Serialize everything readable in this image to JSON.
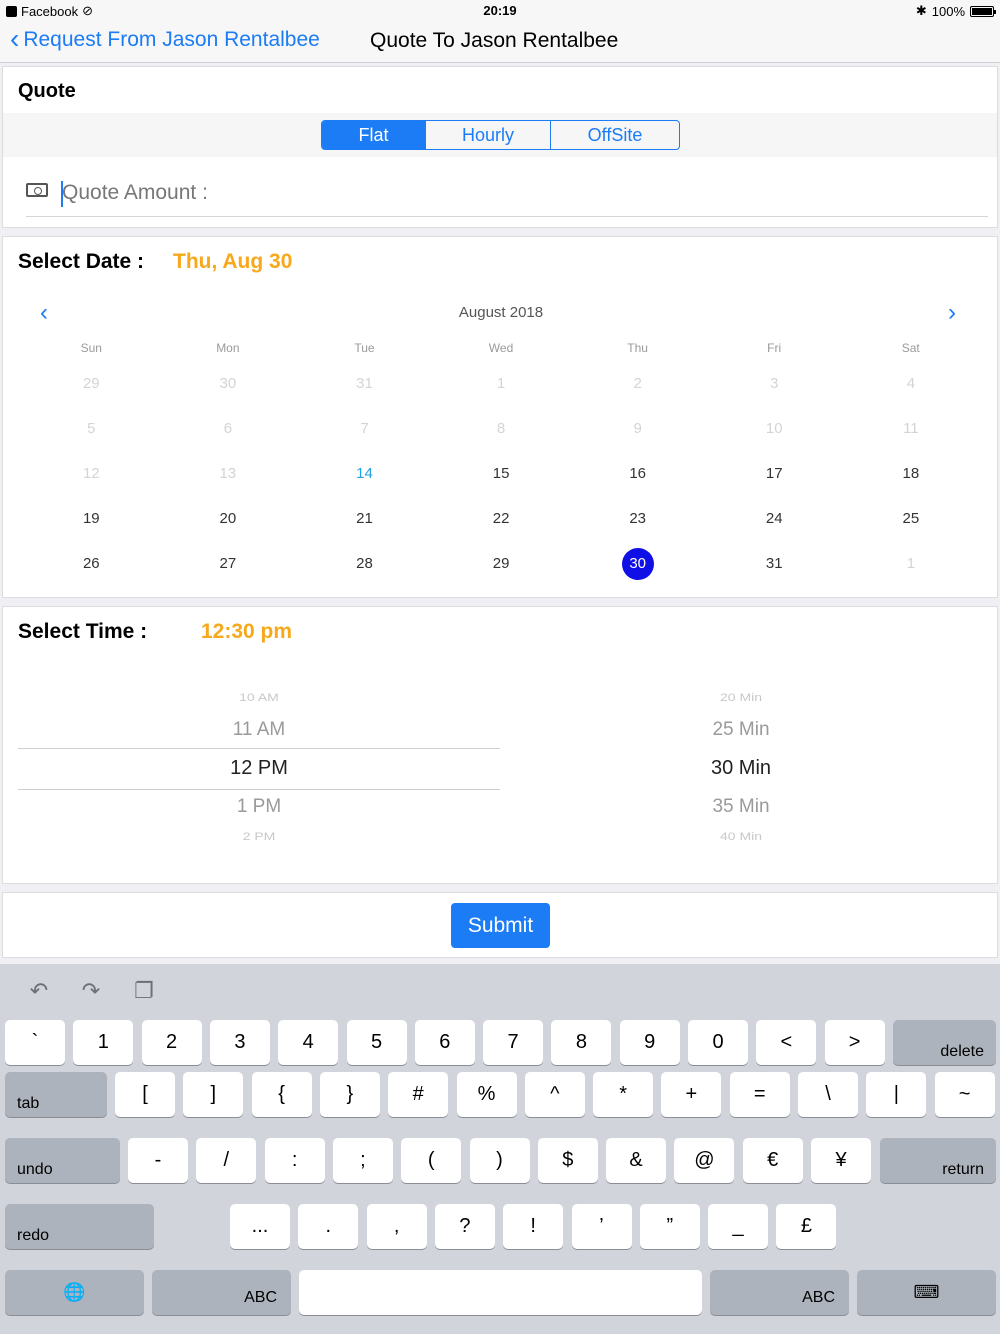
{
  "status_bar": {
    "app": "Facebook",
    "time": "20:19",
    "battery": "100%",
    "battery_fill": 1.0
  },
  "nav": {
    "back_label": "Request From Jason Rentalbee",
    "title": "Quote To Jason Rentalbee"
  },
  "quote": {
    "title": "Quote",
    "segments": [
      "Flat",
      "Hourly",
      "OffSite"
    ],
    "selected_segment": "Flat",
    "amount_placeholder": "Quote Amount :",
    "amount_value": ""
  },
  "date": {
    "label": "Select Date :",
    "value": "Thu, Aug 30",
    "month": "August 2018",
    "weekdays": [
      "Sun",
      "Mon",
      "Tue",
      "Wed",
      "Thu",
      "Fri",
      "Sat"
    ],
    "days": [
      [
        "29",
        "30",
        "31",
        "1",
        "2",
        "3",
        "4"
      ],
      [
        "5",
        "6",
        "7",
        "8",
        "9",
        "10",
        "11"
      ],
      [
        "12",
        "13",
        "14",
        "15",
        "16",
        "17",
        "18"
      ],
      [
        "19",
        "20",
        "21",
        "22",
        "23",
        "24",
        "25"
      ],
      [
        "26",
        "27",
        "28",
        "29",
        "30",
        "31",
        "1"
      ]
    ]
  },
  "time": {
    "label": "Select Time :",
    "value": "12:30 pm",
    "hours": [
      "10 AM",
      "11 AM",
      "12 PM",
      "1 PM",
      "2 PM"
    ],
    "minutes": [
      "20 Min",
      "25 Min",
      "30 Min",
      "35 Min",
      "40 Min"
    ]
  },
  "submit_label": "Submit",
  "keyboard": {
    "row1": [
      "`",
      "1",
      "2",
      "3",
      "4",
      "5",
      "6",
      "7",
      "8",
      "9",
      "0",
      "<",
      ">"
    ],
    "delete": "delete",
    "tab": "tab",
    "row2": [
      "[",
      "]",
      "{",
      "}",
      "#",
      "%",
      "^",
      "*",
      "+",
      "=",
      "\\",
      "|",
      "~"
    ],
    "undo": "undo",
    "row3": [
      "-",
      "/",
      ":",
      ";",
      "(",
      ")",
      "$",
      "&",
      "@",
      "€",
      "¥"
    ],
    "return": "return",
    "redo": "redo",
    "row4": [
      "...",
      ".",
      ",",
      "?",
      "!",
      "’",
      "”",
      "_",
      "£"
    ],
    "abc_left": "ABC",
    "abc_right": "ABC"
  }
}
